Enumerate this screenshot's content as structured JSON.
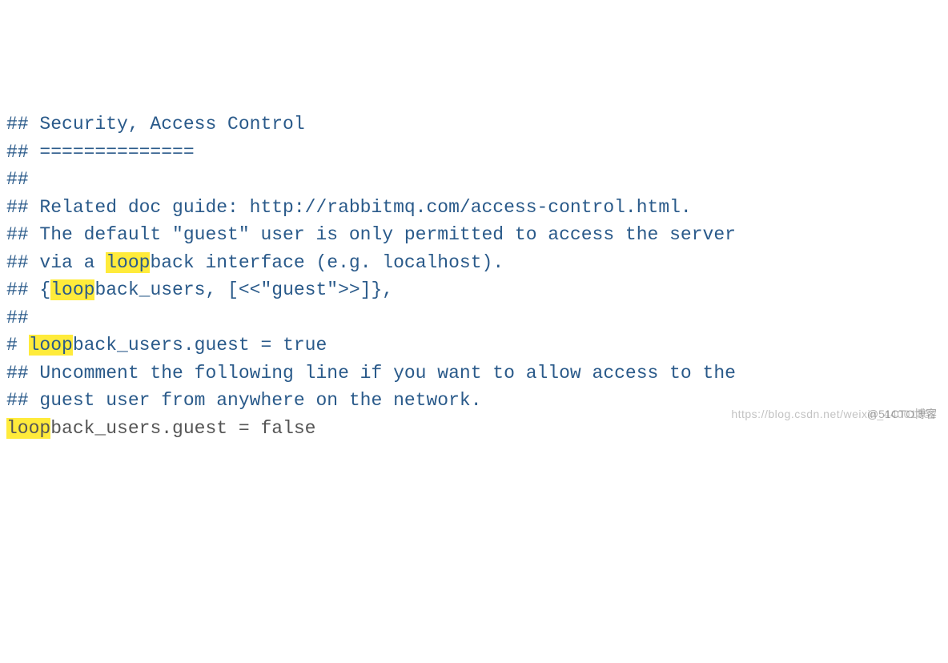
{
  "highlight_term": "loop",
  "lines": {
    "l1": "## Security, Access Control",
    "l2": "## ==============",
    "l3": "##",
    "l4": "",
    "l5": "## Related doc guide: http://rabbitmq.com/access-control.html.",
    "l6": "",
    "l7": "## The default \"guest\" user is only permitted to access the server",
    "l8_pre": "## via a ",
    "l8_hl": "loop",
    "l8_post": "back interface (e.g. localhost).",
    "l9_pre": "## {",
    "l9_hl": "loop",
    "l9_post": "back_users, [<<\"guest\">>]},",
    "l10": "##",
    "l11_pre": "# ",
    "l11_hl": "loop",
    "l11_post": "back_users.guest = true",
    "l12": "",
    "l13": "## Uncomment the following line if you want to allow access to the",
    "l14": "## guest user from anywhere on the network.",
    "l15_hl": "loop",
    "l15_post": "back_users.guest = false"
  },
  "watermark1": "https://blog.csdn.net/weixin_44001352",
  "watermark2": "@51CTO博客"
}
